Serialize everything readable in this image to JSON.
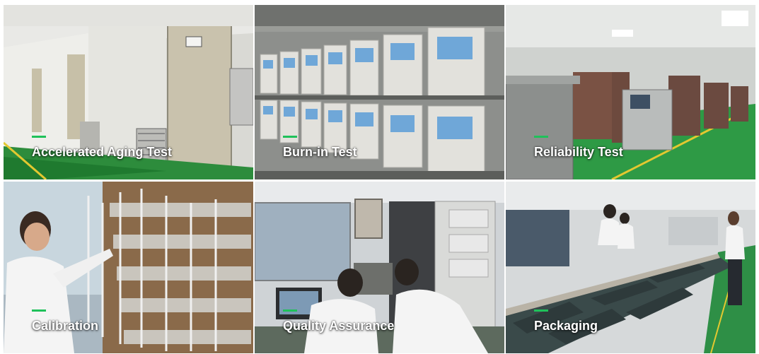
{
  "tiles": [
    {
      "caption": "Accelerated Aging Test",
      "accent_color": "#1fc15a"
    },
    {
      "caption": "Burn-in Test",
      "accent_color": "#1fc15a"
    },
    {
      "caption": "Reliability Test",
      "accent_color": "#1fc15a"
    },
    {
      "caption": "Calibration",
      "accent_color": "#1fc15a"
    },
    {
      "caption": "Quality Assurance",
      "accent_color": "#1fc15a"
    },
    {
      "caption": "Packaging",
      "accent_color": "#1fc15a"
    }
  ]
}
